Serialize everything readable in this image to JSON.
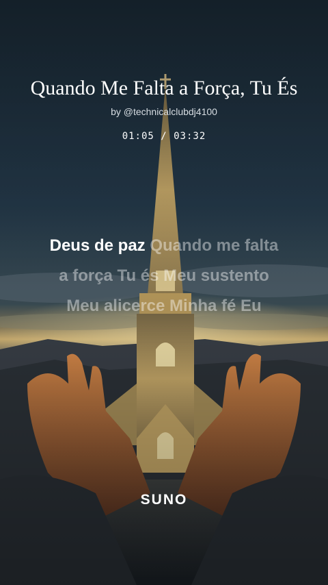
{
  "song": {
    "title": "Quando Me Falta a Força, Tu És",
    "author": "by @technicalclubdj4100",
    "time": "01:05 / 03:32"
  },
  "lyrics": {
    "active": "Deus de paz",
    "upcoming_line1": "Quando me falta",
    "upcoming_line2": "a força Tu és Meu sustento",
    "upcoming_line3": "Meu alicerce Minha fé Eu"
  },
  "brand": {
    "logo": "SUNO"
  },
  "colors": {
    "sky_top": "#1a2a36",
    "sunset": "#e6c27a",
    "church": "#c9a968",
    "hands": "#b86b3a"
  }
}
